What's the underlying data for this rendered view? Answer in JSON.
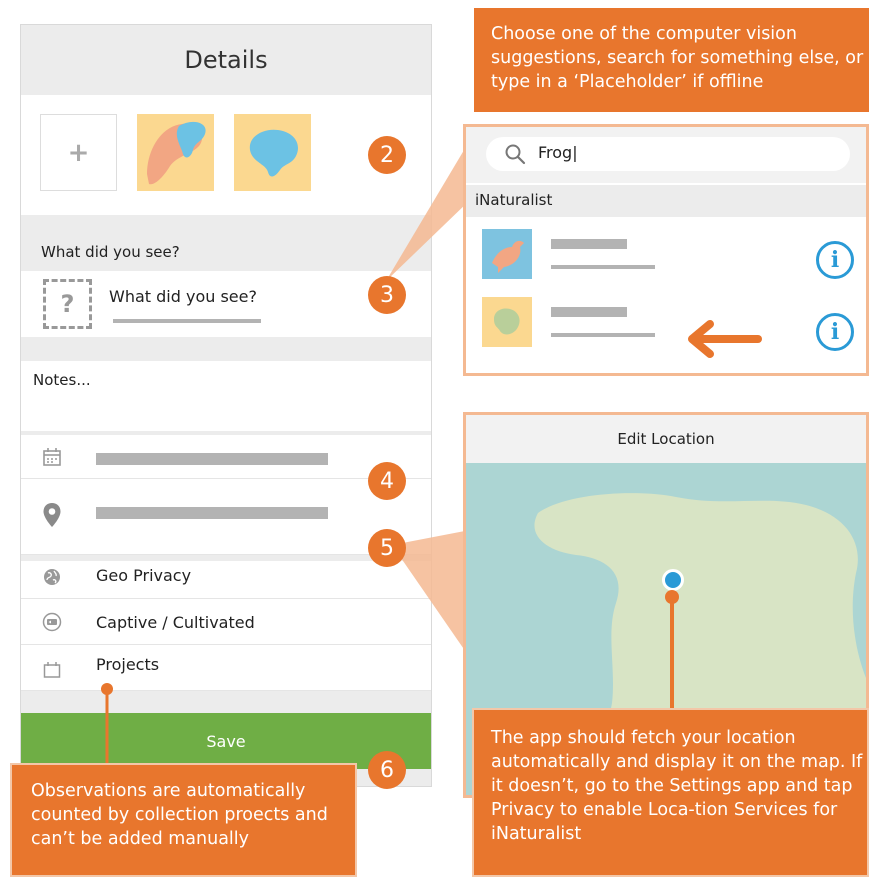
{
  "details": {
    "title": "Details",
    "add_photo_glyph": "+",
    "what_label": "What did you see?",
    "what_placeholder": "What did you see?",
    "unknown_glyph": "?",
    "notes_placeholder": "Notes...",
    "geo_privacy": "Geo Privacy",
    "captive": "Captive / Cultivated",
    "projects": "Projects",
    "save": "Save"
  },
  "badges": [
    "2",
    "3",
    "4",
    "5",
    "6"
  ],
  "callouts": {
    "top": "Choose one of the computer vision suggestions, search for something else, or type in a ‘Placeholder’ if offline",
    "bottom_left": "Observations are automatically counted by collection proects and can’t be added manually",
    "bottom_right": "The app should fetch your location automatically and display it on the map. If it doesn’t,  go to the Settings app and tap Privacy to enable Loca-tion Services for iNaturalist"
  },
  "search": {
    "query": "Frog|",
    "section": "iNaturalist",
    "info_glyph": "i"
  },
  "location": {
    "title": "Edit Location"
  },
  "icons": [
    "plus-icon",
    "unknown-species-icon",
    "calendar-icon",
    "location-pin-icon",
    "globe-icon",
    "captive-icon",
    "projects-icon",
    "search-icon",
    "bird-icon",
    "frog-icon",
    "info-icon",
    "arrow-left-icon"
  ],
  "colors": {
    "accent": "#e8762d",
    "save": "#6fae45",
    "info": "#2a9ad6",
    "map_water": "#acd5d3",
    "map_land": "#d8e4c5",
    "thumb_bg": "#fbd890"
  }
}
